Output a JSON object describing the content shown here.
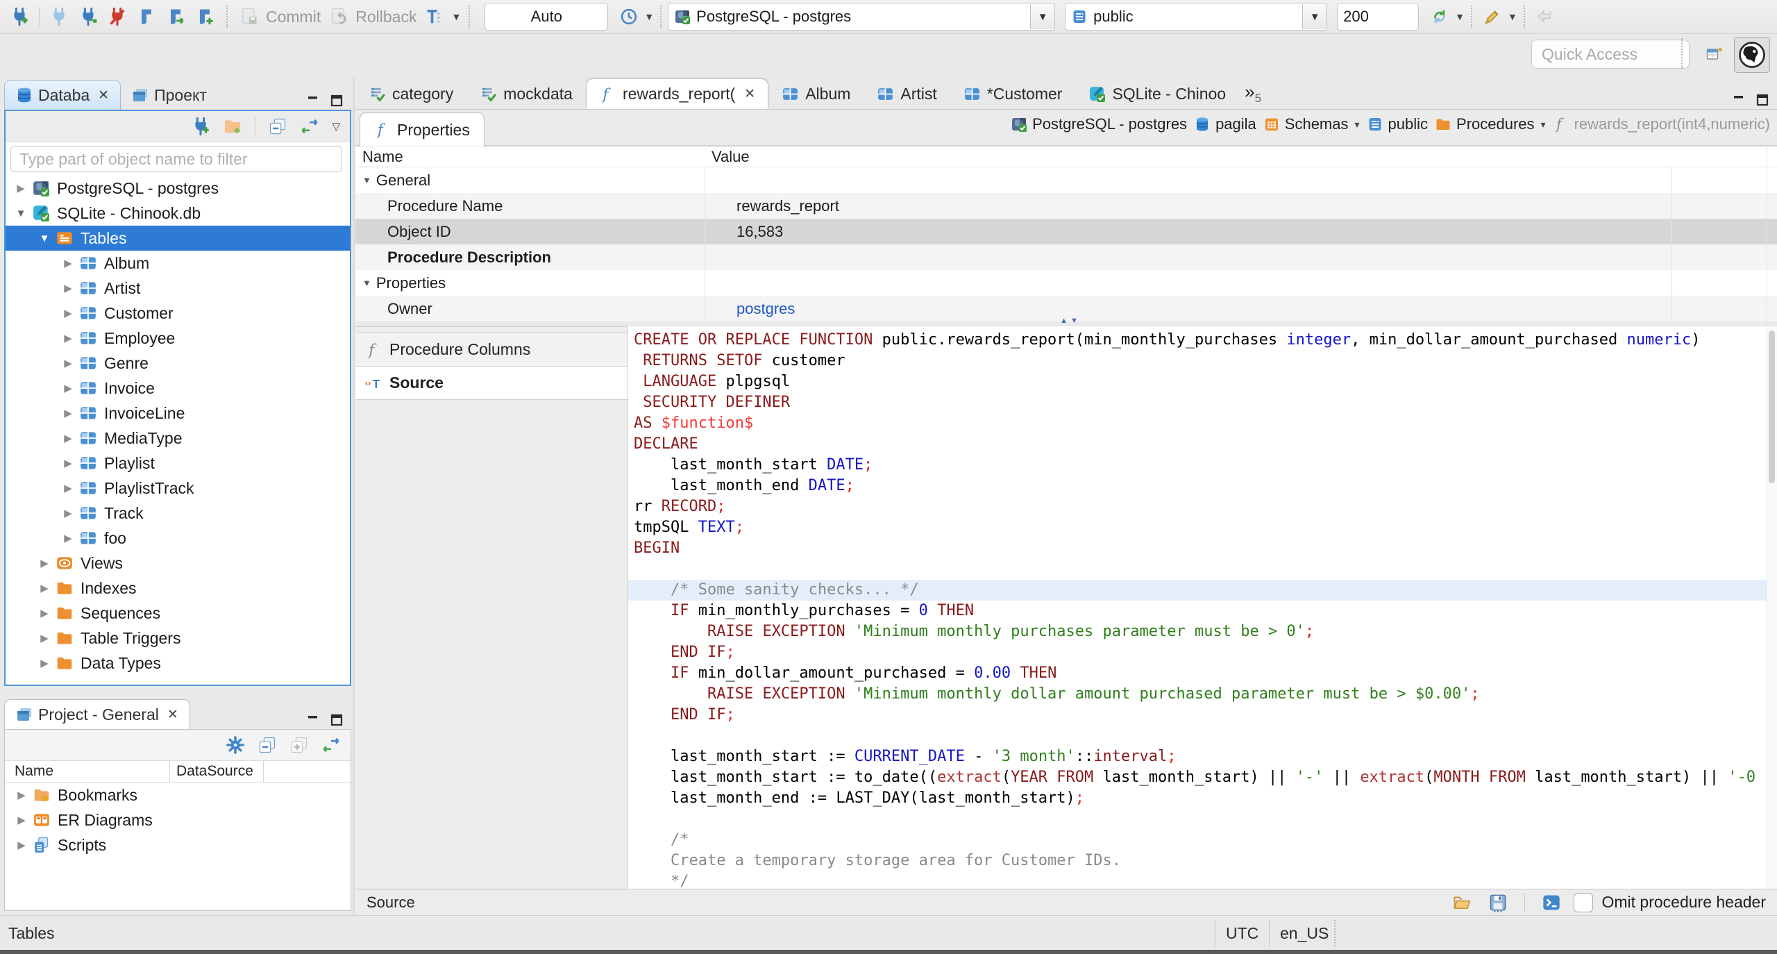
{
  "toolbar": {
    "auto_label": "Auto",
    "commit_label": "Commit",
    "rollback_label": "Rollback",
    "connection": "PostgreSQL - postgres",
    "schema": "public",
    "fetch_size": "200",
    "quick_access_placeholder": "Quick Access"
  },
  "navigator": {
    "tab_database": "Databa",
    "tab_project": "Проект",
    "filter_placeholder": "Type part of object name to filter",
    "tree": [
      {
        "arrow": "r",
        "icon": "pg",
        "label": "PostgreSQL - postgres",
        "depth": 0
      },
      {
        "arrow": "d",
        "icon": "sqlite",
        "label": "SQLite - Chinook.db",
        "depth": 0
      },
      {
        "arrow": "d",
        "icon": "tables",
        "label": "Tables",
        "depth": 1,
        "selected": true
      },
      {
        "arrow": "r",
        "icon": "table",
        "label": "Album",
        "depth": 2
      },
      {
        "arrow": "r",
        "icon": "table",
        "label": "Artist",
        "depth": 2
      },
      {
        "arrow": "r",
        "icon": "table",
        "label": "Customer",
        "depth": 2
      },
      {
        "arrow": "r",
        "icon": "table",
        "label": "Employee",
        "depth": 2
      },
      {
        "arrow": "r",
        "icon": "table",
        "label": "Genre",
        "depth": 2
      },
      {
        "arrow": "r",
        "icon": "table",
        "label": "Invoice",
        "depth": 2
      },
      {
        "arrow": "r",
        "icon": "table",
        "label": "InvoiceLine",
        "depth": 2
      },
      {
        "arrow": "r",
        "icon": "table",
        "label": "MediaType",
        "depth": 2
      },
      {
        "arrow": "r",
        "icon": "table",
        "label": "Playlist",
        "depth": 2
      },
      {
        "arrow": "r",
        "icon": "table",
        "label": "PlaylistTrack",
        "depth": 2
      },
      {
        "arrow": "r",
        "icon": "table",
        "label": "Track",
        "depth": 2
      },
      {
        "arrow": "r",
        "icon": "table",
        "label": "foo",
        "depth": 2
      },
      {
        "arrow": "r",
        "icon": "eye",
        "label": "Views",
        "depth": 1
      },
      {
        "arrow": "r",
        "icon": "folder",
        "label": "Indexes",
        "depth": 1
      },
      {
        "arrow": "r",
        "icon": "folder",
        "label": "Sequences",
        "depth": 1
      },
      {
        "arrow": "r",
        "icon": "folder",
        "label": "Table Triggers",
        "depth": 1
      },
      {
        "arrow": "r",
        "icon": "folder",
        "label": "Data Types",
        "depth": 1
      }
    ]
  },
  "project_panel": {
    "title": "Project - General",
    "col_name": "Name",
    "col_datasource": "DataSource",
    "items": [
      {
        "icon": "bookmarks",
        "label": "Bookmarks"
      },
      {
        "icon": "er",
        "label": "ER Diagrams"
      },
      {
        "icon": "scripts",
        "label": "Scripts"
      }
    ]
  },
  "editor": {
    "tabs": [
      {
        "icon": "script",
        "label": "category"
      },
      {
        "icon": "script",
        "label": "mockdata"
      },
      {
        "icon": "func",
        "label": "rewards_report(",
        "active": true,
        "close": true
      },
      {
        "icon": "table",
        "label": "Album"
      },
      {
        "icon": "table",
        "label": "Artist"
      },
      {
        "icon": "table",
        "label": "*Customer"
      },
      {
        "icon": "sqlite",
        "label": "SQLite - Chinoo"
      }
    ],
    "overflow_count": "5",
    "properties_tab": "Properties",
    "breadcrumb": [
      {
        "icon": "pg",
        "label": "PostgreSQL - postgres"
      },
      {
        "icon": "dbblue",
        "label": "pagila"
      },
      {
        "icon": "schemas",
        "label": "Schemas",
        "dd": true
      },
      {
        "icon": "schema",
        "label": "public"
      },
      {
        "icon": "folder",
        "label": "Procedures",
        "dd": true
      },
      {
        "icon": "funcgray",
        "label": "rewards_report(int4,numeric)",
        "muted": true
      }
    ],
    "grid": {
      "col_name": "Name",
      "col_value": "Value",
      "rows": [
        {
          "name": "General",
          "group": true
        },
        {
          "name": "Procedure Name",
          "value": "rewards_report",
          "child": true,
          "alt": true
        },
        {
          "name": "Object ID",
          "value": "16,583",
          "child": true,
          "selected": true
        },
        {
          "name": "Procedure Description",
          "child": true,
          "bold": true,
          "alt": true
        },
        {
          "name": "Properties",
          "group": true
        },
        {
          "name": "Owner",
          "value": "postgres",
          "child": true,
          "link": true,
          "alt": true
        }
      ]
    },
    "subtabs": [
      {
        "icon": "funcgray",
        "label": "Procedure Columns"
      },
      {
        "icon": "source",
        "label": "Source",
        "active": true
      }
    ],
    "code_lines": [
      {
        "seg": [
          [
            "k",
            "CREATE OR REPLACE FUNCTION"
          ],
          [
            "p",
            " public.rewards_report(min_monthly_purchases "
          ],
          [
            "t",
            "integer"
          ],
          [
            "p",
            ", min_dollar_amount_purchased "
          ],
          [
            "t",
            "numeric"
          ],
          [
            "p",
            ")"
          ]
        ]
      },
      {
        "seg": [
          [
            "p",
            " "
          ],
          [
            "k",
            "RETURNS SETOF"
          ],
          [
            "p",
            " customer"
          ]
        ]
      },
      {
        "seg": [
          [
            "p",
            " "
          ],
          [
            "k",
            "LANGUAGE"
          ],
          [
            "p",
            " plpgsql"
          ]
        ]
      },
      {
        "seg": [
          [
            "p",
            " "
          ],
          [
            "k",
            "SECURITY DEFINER"
          ]
        ]
      },
      {
        "seg": [
          [
            "k",
            "AS"
          ],
          [
            "x",
            " $function$"
          ]
        ]
      },
      {
        "seg": [
          [
            "k",
            "DECLARE"
          ]
        ]
      },
      {
        "seg": [
          [
            "p",
            "    last_month_start "
          ],
          [
            "t",
            "DATE"
          ],
          [
            "d",
            ";"
          ]
        ]
      },
      {
        "seg": [
          [
            "p",
            "    last_month_end "
          ],
          [
            "t",
            "DATE"
          ],
          [
            "d",
            ";"
          ]
        ]
      },
      {
        "seg": [
          [
            "p",
            "rr "
          ],
          [
            "k",
            "RECORD"
          ],
          [
            "d",
            ";"
          ]
        ]
      },
      {
        "seg": [
          [
            "p",
            "tmpSQL "
          ],
          [
            "t",
            "TEXT"
          ],
          [
            "d",
            ";"
          ]
        ]
      },
      {
        "seg": [
          [
            "k",
            "BEGIN"
          ]
        ]
      },
      {
        "seg": []
      },
      {
        "hl": true,
        "seg": [
          [
            "c",
            "    /* Some sanity checks... */"
          ]
        ]
      },
      {
        "seg": [
          [
            "p",
            "    "
          ],
          [
            "k",
            "IF"
          ],
          [
            "p",
            " min_monthly_purchases = "
          ],
          [
            "t",
            "0"
          ],
          [
            "p",
            " "
          ],
          [
            "k",
            "THEN"
          ]
        ]
      },
      {
        "seg": [
          [
            "p",
            "        "
          ],
          [
            "k",
            "RAISE EXCEPTION"
          ],
          [
            "p",
            " "
          ],
          [
            "s",
            "'Minimum monthly purchases parameter must be > 0'"
          ],
          [
            "d",
            ";"
          ]
        ]
      },
      {
        "seg": [
          [
            "p",
            "    "
          ],
          [
            "k",
            "END IF"
          ],
          [
            "d",
            ";"
          ]
        ]
      },
      {
        "seg": [
          [
            "p",
            "    "
          ],
          [
            "k",
            "IF"
          ],
          [
            "p",
            " min_dollar_amount_purchased = "
          ],
          [
            "t",
            "0.00"
          ],
          [
            "p",
            " "
          ],
          [
            "k",
            "THEN"
          ]
        ]
      },
      {
        "seg": [
          [
            "p",
            "        "
          ],
          [
            "k",
            "RAISE EXCEPTION"
          ],
          [
            "p",
            " "
          ],
          [
            "s",
            "'Minimum monthly dollar amount purchased parameter must be > $0.00'"
          ],
          [
            "d",
            ";"
          ]
        ]
      },
      {
        "seg": [
          [
            "p",
            "    "
          ],
          [
            "k",
            "END IF"
          ],
          [
            "d",
            ";"
          ]
        ]
      },
      {
        "seg": []
      },
      {
        "seg": [
          [
            "p",
            "    last_month_start := "
          ],
          [
            "t",
            "CURRENT_DATE"
          ],
          [
            "p",
            " - "
          ],
          [
            "s",
            "'3 month'"
          ],
          [
            "p",
            "::"
          ],
          [
            "k",
            "interval"
          ],
          [
            "d",
            ";"
          ]
        ]
      },
      {
        "seg": [
          [
            "p",
            "    last_month_start := to_date(("
          ],
          [
            "f",
            "extract"
          ],
          [
            "p",
            "("
          ],
          [
            "k",
            "YEAR FROM"
          ],
          [
            "p",
            " last_month_start) || "
          ],
          [
            "s",
            "'-'"
          ],
          [
            "p",
            " || "
          ],
          [
            "f",
            "extract"
          ],
          [
            "p",
            "("
          ],
          [
            "k",
            "MONTH FROM"
          ],
          [
            "p",
            " last_month_start) || "
          ],
          [
            "s",
            "'-0"
          ]
        ]
      },
      {
        "seg": [
          [
            "p",
            "    last_month_end := LAST_DAY(last_month_start)"
          ],
          [
            "d",
            ";"
          ]
        ]
      },
      {
        "seg": []
      },
      {
        "seg": [
          [
            "c",
            "    /*"
          ]
        ]
      },
      {
        "seg": [
          [
            "c",
            "    Create a temporary storage area for Customer IDs."
          ]
        ]
      },
      {
        "seg": [
          [
            "c",
            "    */"
          ]
        ]
      }
    ],
    "footer": {
      "label": "Source",
      "omit_label": "Omit procedure header"
    }
  },
  "statusbar": {
    "left": "Tables",
    "timezone": "UTC",
    "locale": "en_US"
  }
}
